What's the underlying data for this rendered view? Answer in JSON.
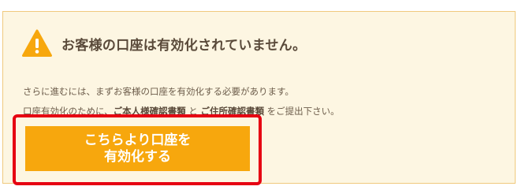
{
  "notice": {
    "title": "お客様の口座は有効化されていません。",
    "line1": "さらに進むには、まずお客様の口座を有効化する必要があります。",
    "line2": {
      "part1": "口座有効化のために、",
      "doc1": "ご本人様確認書類",
      "part2": " と ",
      "doc2": "ご住所確認書類",
      "part3": " をご提出下さい。"
    }
  },
  "cta": {
    "label_line1": "こちらより口座を",
    "label_line2": "有効化する"
  },
  "colors": {
    "panel_bg": "#fdf6e2",
    "panel_border": "#f0c97e",
    "warning": "#f7a70d",
    "button": "#f7a70d",
    "highlight_frame": "#e60012"
  },
  "icons": {
    "warning": "warning-triangle-icon"
  }
}
